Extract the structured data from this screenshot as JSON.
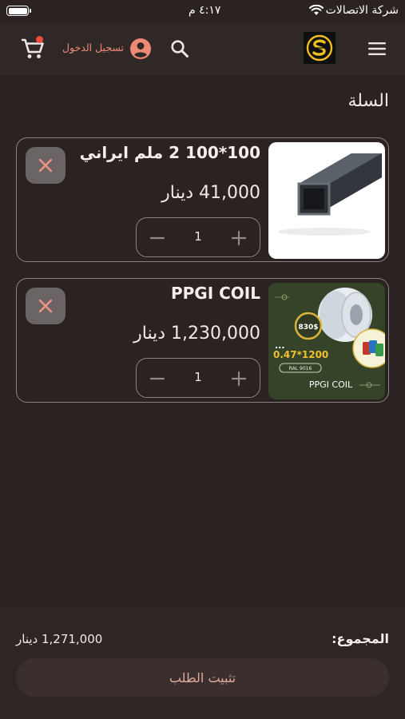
{
  "status_bar": {
    "carrier": "شركة الاتصالات",
    "time": "٤:١٧ م",
    "battery_level": 1.0
  },
  "app_bar": {
    "menu_icon": "menu-icon",
    "logo_icon": "brand-logo",
    "search_icon": "search-icon",
    "account_icon": "account-circle-icon",
    "login_label": "تسجيل الدخول",
    "cart_icon": "shopping-cart-icon"
  },
  "page": {
    "title": "السلة"
  },
  "cart": {
    "items": [
      {
        "name": "100*100 2 ملم ايراني",
        "price": "41,000 دينار",
        "quantity": "1",
        "image_icon": "square-steel-tube"
      },
      {
        "name": "PPGI COIL",
        "price": "1,230,000 دينار",
        "quantity": "1",
        "image_icon": "ppgi-coil-promo"
      }
    ]
  },
  "promo_image": {
    "badge_price": "830$",
    "spec": "0.47*1200",
    "dots": "...",
    "ral": "RAL 9016",
    "caption": "PPGI COIL"
  },
  "summary": {
    "total_label": "المجموع:",
    "total_value": "1,271,000 دينار"
  },
  "checkout": {
    "label": "تثبيت الطلب"
  },
  "colors": {
    "background": "#2a2322",
    "app_bar": "#2f2827",
    "accent": "#f08a78",
    "cart_badge": "#ee4d3c",
    "remove_icon": "#f09484",
    "checkout_bg": "#3a2f2e",
    "checkout_text": "#e0a89c",
    "logo_gold": "#f0c020"
  }
}
